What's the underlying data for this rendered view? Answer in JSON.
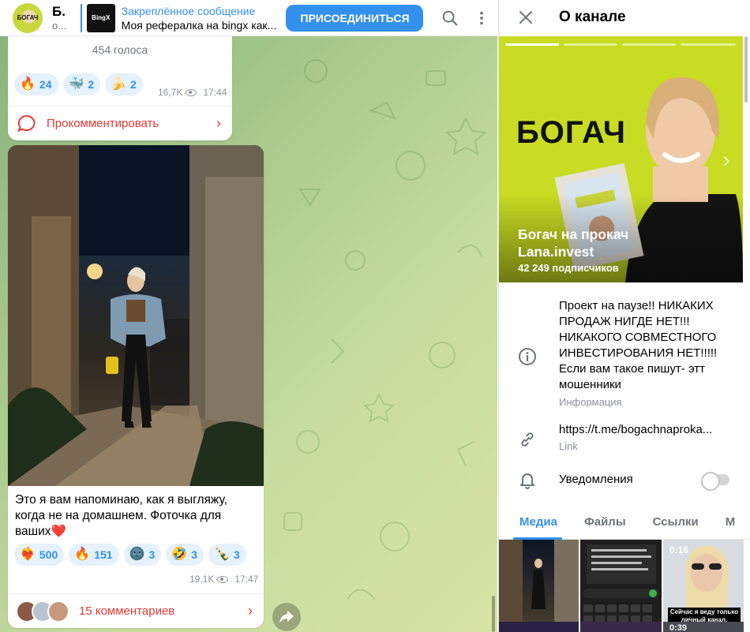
{
  "header": {
    "channel_title": "Б.",
    "channel_sub": "о...",
    "avatar_text": "БОГАЧ",
    "pin_label": "Закреплённое сообщение",
    "pin_thumb_text": "BingX",
    "pin_message": "Моя рефералка на bingx как...",
    "join_label": "ПРИСОЕДИНИТЬСЯ"
  },
  "message1": {
    "votes": "454 голоса",
    "reactions": [
      {
        "emoji": "🔥",
        "count": "24"
      },
      {
        "emoji": "🐳",
        "count": "2"
      },
      {
        "emoji": "🍌",
        "count": "2"
      }
    ],
    "views": "16,7K",
    "time": "17:44",
    "comment_label": "Прокомментировать"
  },
  "message2": {
    "text": "Это я вам напоминаю, как я выгляжу, когда не на домашнем. Фоточка для ваших❤️",
    "reactions": [
      {
        "emoji": "❤️‍🔥",
        "count": "500"
      },
      {
        "emoji": "🔥",
        "count": "151"
      },
      {
        "emoji": "🌚",
        "count": "3"
      },
      {
        "emoji": "🤣",
        "count": "3"
      },
      {
        "emoji": "🍾",
        "count": "3"
      }
    ],
    "views": "19,1K",
    "time": "17:47",
    "comments_label": "15 комментариев"
  },
  "info": {
    "title": "О канале",
    "banner_word": "БОГАЧ",
    "channel_name": "Богач на прокач Lana.invest",
    "subscribers": "42 249 подписчиков",
    "description": "Проект на паузе!! НИКАКИХ ПРОДАЖ НИГДЕ НЕТ!!! НИКАКОГО СОВМЕСТНОГО ИНВЕСТИРОВАНИЯ НЕТ!!!!! Если вам такое пишут- этт мошенники",
    "description_caption": "Информация",
    "link": "https://t.me/bogachnaproka...",
    "link_caption": "Link",
    "notifications_label": "Уведомления",
    "notifications_on": false,
    "tabs": [
      "Медиа",
      "Файлы",
      "Ссылки",
      "М"
    ],
    "tiles": [
      {
        "duration": ""
      },
      {
        "duration": ""
      },
      {
        "duration": "0:16"
      },
      {
        "duration": "0:39"
      }
    ],
    "tile_caption": "Сейчас я веду только личный канал. Никакой"
  },
  "colors": {
    "accent": "#3390ec",
    "comment_red": "#e53935",
    "banner_green": "#c7dc22"
  }
}
